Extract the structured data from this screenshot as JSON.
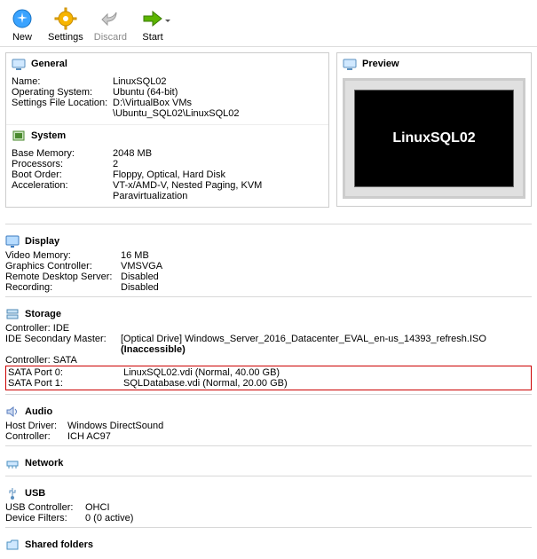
{
  "toolbar": {
    "new": "New",
    "settings": "Settings",
    "discard": "Discard",
    "start": "Start"
  },
  "sections": {
    "general": "General",
    "preview": "Preview",
    "system": "System",
    "display": "Display",
    "storage": "Storage",
    "audio": "Audio",
    "network": "Network",
    "usb": "USB",
    "shared": "Shared folders"
  },
  "general": {
    "name_k": "Name:",
    "name_v": "LinuxSQL02",
    "os_k": "Operating System:",
    "os_v": "Ubuntu (64-bit)",
    "sfl_k": "Settings File Location:",
    "sfl_v1": "D:\\VirtualBox VMs",
    "sfl_v2": "\\Ubuntu_SQL02\\LinuxSQL02"
  },
  "preview_title": "LinuxSQL02",
  "system": {
    "mem_k": "Base Memory:",
    "mem_v": "2048 MB",
    "proc_k": "Processors:",
    "proc_v": "2",
    "boot_k": "Boot Order:",
    "boot_v": "Floppy, Optical, Hard Disk",
    "acc_k": "Acceleration:",
    "acc_v": "VT-x/AMD-V, Nested Paging, KVM Paravirtualization"
  },
  "display": {
    "vmem_k": "Video Memory:",
    "vmem_v": "16 MB",
    "gc_k": "Graphics Controller:",
    "gc_v": "VMSVGA",
    "rds_k": "Remote Desktop Server:",
    "rds_v": "Disabled",
    "rec_k": "Recording:",
    "rec_v": "Disabled"
  },
  "storage": {
    "ctrl_ide": "Controller: IDE",
    "ide_sec_k": "IDE Secondary Master:",
    "ide_sec_v": "[Optical Drive] Windows_Server_2016_Datacenter_EVAL_en-us_14393_refresh.ISO",
    "ide_sec_inacc": "(Inaccessible)",
    "ctrl_sata": "Controller: SATA",
    "sata0_k": "SATA Port 0:",
    "sata0_v": "LinuxSQL02.vdi (Normal, 40.00 GB)",
    "sata1_k": "SATA Port 1:",
    "sata1_v": "SQLDatabase.vdi (Normal, 20.00 GB)"
  },
  "audio": {
    "host_k": "Host Driver:",
    "host_v": "Windows DirectSound",
    "ctrl_k": "Controller:",
    "ctrl_v": "ICH AC97"
  },
  "usb": {
    "ctrl_k": "USB Controller:",
    "ctrl_v": "OHCI",
    "flt_k": "Device Filters:",
    "flt_v": "0 (0 active)"
  }
}
